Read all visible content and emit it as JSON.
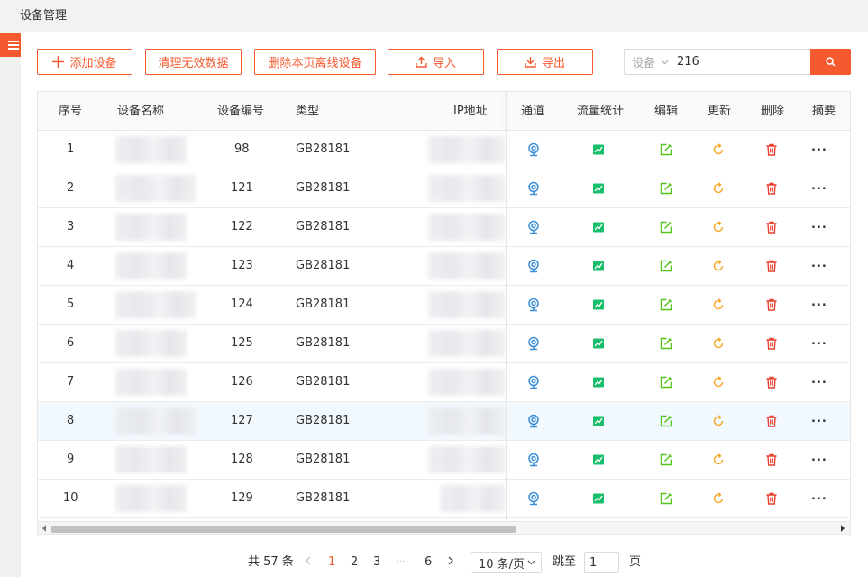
{
  "page_title": "设备管理",
  "toolbar": {
    "add_label": "添加设备",
    "clean_label": "清理无效数据",
    "delete_offline_label": "删除本页离线设备",
    "import_label": "导入",
    "export_label": "导出"
  },
  "search": {
    "field_label": "设备",
    "value": "216"
  },
  "table": {
    "columns": {
      "index": "序号",
      "name": "设备名称",
      "code": "设备编号",
      "type": "类型",
      "ip": "IP地址",
      "channel": "通道",
      "traffic": "流量统计",
      "edit": "编辑",
      "update": "更新",
      "delete": "删除",
      "summary": "摘要"
    },
    "rows": [
      {
        "index": "1",
        "code": "98",
        "type": "GB28181",
        "more": "..."
      },
      {
        "index": "2",
        "code": "121",
        "type": "GB28181",
        "more": "..."
      },
      {
        "index": "3",
        "code": "122",
        "type": "GB28181",
        "more": "..."
      },
      {
        "index": "4",
        "code": "123",
        "type": "GB28181",
        "more": "..."
      },
      {
        "index": "5",
        "code": "124",
        "type": "GB28181",
        "more": "..."
      },
      {
        "index": "6",
        "code": "125",
        "type": "GB28181",
        "more": "..."
      },
      {
        "index": "7",
        "code": "126",
        "type": "GB28181",
        "more": "..."
      },
      {
        "index": "8",
        "code": "127",
        "type": "GB28181",
        "more": "..."
      },
      {
        "index": "9",
        "code": "128",
        "type": "GB28181",
        "more": "..."
      },
      {
        "index": "10",
        "code": "129",
        "type": "GB28181",
        "more": "..."
      }
    ],
    "highlighted_row_index": 7
  },
  "pagination": {
    "total_text": "共 57 条",
    "pages": [
      "1",
      "2",
      "3",
      "6"
    ],
    "ellipsis": "···",
    "current_page": "1",
    "page_size_text": "10 条/页",
    "jump_label": "跳至",
    "jump_value": "1",
    "page_suffix": "页"
  },
  "colors": {
    "accent": "#f45a2e",
    "channel_icon": "#3b8fd8",
    "traffic_icon": "#19be6b",
    "edit_icon": "#52c41a",
    "update_icon": "#f5a623",
    "delete_icon": "#e8402e",
    "highlight_row": "#f1f8fe"
  },
  "icons": {
    "menu": "menu-icon",
    "add": "plus-icon",
    "import": "upload-icon",
    "export": "download-icon",
    "search": "search-icon",
    "channel": "webcam-icon",
    "traffic": "chart-icon",
    "edit": "edit-icon",
    "update": "refresh-icon",
    "delete": "trash-icon"
  }
}
